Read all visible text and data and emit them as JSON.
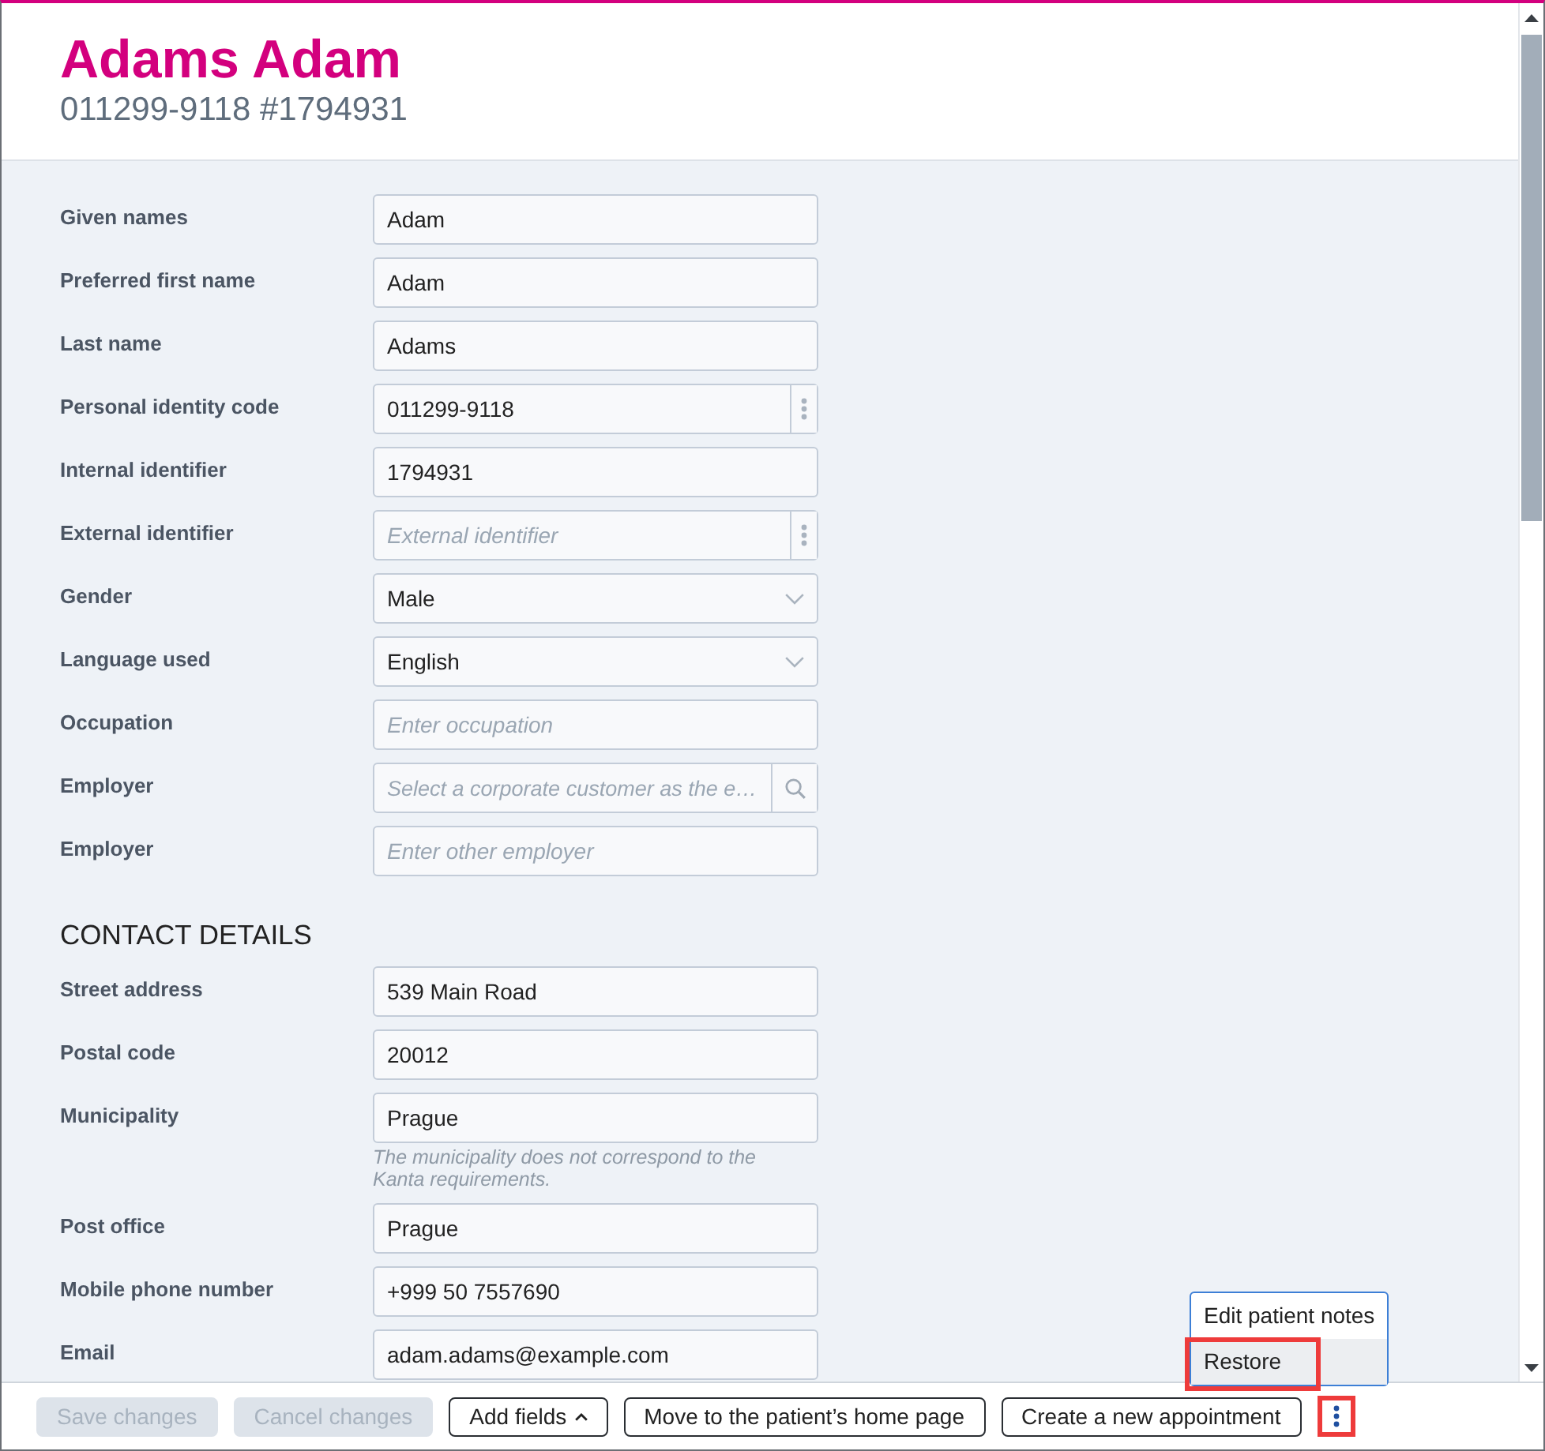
{
  "header": {
    "name": "Adams Adam",
    "subtitle": "011299-9118 #1794931"
  },
  "sections": [
    {
      "fields": [
        {
          "label": "Given names",
          "kind": "text",
          "value": "Adam"
        },
        {
          "label": "Preferred first name",
          "kind": "text",
          "value": "Adam"
        },
        {
          "label": "Last name",
          "kind": "text",
          "value": "Adams"
        },
        {
          "label": "Personal identity code",
          "kind": "menu",
          "value": "011299-9118"
        },
        {
          "label": "Internal identifier",
          "kind": "text",
          "value": "1794931"
        },
        {
          "label": "External identifier",
          "kind": "menu",
          "placeholder": "External identifier"
        },
        {
          "label": "Gender",
          "kind": "select",
          "value": "Male"
        },
        {
          "label": "Language used",
          "kind": "select",
          "value": "English"
        },
        {
          "label": "Occupation",
          "kind": "text",
          "placeholder": "Enter occupation"
        },
        {
          "label": "Employer",
          "kind": "search",
          "placeholder": "Select a corporate customer as the e…"
        },
        {
          "label": "Employer",
          "kind": "text",
          "placeholder": "Enter other employer"
        }
      ]
    },
    {
      "heading": "CONTACT DETAILS",
      "fields": [
        {
          "label": "Street address",
          "kind": "text",
          "value": "539 Main Road"
        },
        {
          "label": "Postal code",
          "kind": "text",
          "value": "20012"
        },
        {
          "label": "Municipality",
          "kind": "text",
          "value": "Prague",
          "help_text": "The municipality does not correspond to the Kanta requirements."
        },
        {
          "label": "Post office",
          "kind": "text",
          "value": "Prague"
        },
        {
          "label": "Mobile phone number",
          "kind": "text",
          "value": "+999 50 7557690"
        },
        {
          "label": "Email",
          "kind": "text",
          "value": "adam.adams@example.com"
        }
      ]
    }
  ],
  "footer": {
    "buttons": [
      {
        "label": "Save changes",
        "kind": "plain",
        "disabled": true
      },
      {
        "label": "Cancel changes",
        "kind": "plain",
        "disabled": true
      },
      {
        "label": "Add fields",
        "kind": "caret",
        "disabled": false
      },
      {
        "label": "Move to the patient’s home page",
        "kind": "plain",
        "disabled": false
      },
      {
        "label": "Create a new appointment",
        "kind": "plain",
        "disabled": false
      }
    ],
    "more_button": {
      "highlighted": true
    }
  },
  "menu": {
    "items": [
      {
        "label": "Edit patient notes",
        "selected": false,
        "highlighted": false
      },
      {
        "label": "Restore",
        "selected": true,
        "highlighted": true
      }
    ]
  }
}
